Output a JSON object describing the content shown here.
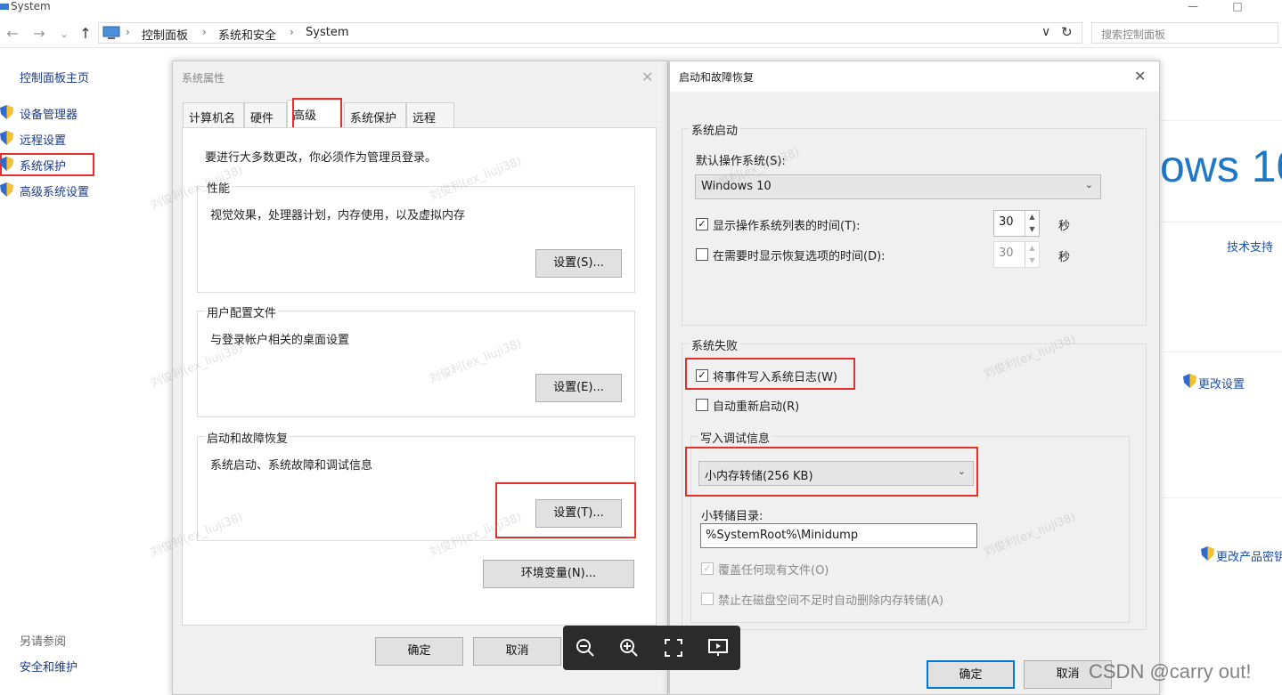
{
  "window": {
    "title": "System",
    "minimize": "—",
    "maximize": "□"
  },
  "nav": {
    "back": "←",
    "forward": "→",
    "history": "⌄",
    "up": "↑",
    "crumbs": [
      "控制面板",
      "系统和安全",
      "System"
    ],
    "dropdown": "∨",
    "refresh": "↻",
    "search_placeholder": "搜索控制面板"
  },
  "sidebar": {
    "home": "控制面板主页",
    "items": [
      "设备管理器",
      "远程设置",
      "系统保护",
      "高级系统设置"
    ],
    "see_also_title": "另请参阅",
    "see_also": [
      "安全和维护"
    ]
  },
  "right_pane": {
    "windows_logo_text": "ows 10",
    "tech_support": "技术支持",
    "change_settings": "更改设置",
    "change_product_key": "更改产品密钥"
  },
  "sys_props": {
    "title": "系统属性",
    "close": "✕",
    "tabs": [
      "计算机名",
      "硬件",
      "高级",
      "系统保护",
      "远程"
    ],
    "admin_note": "要进行大多数更改，你必须作为管理员登录。",
    "performance": {
      "label": "性能",
      "desc": "视觉效果，处理器计划，内存使用，以及虚拟内存",
      "button": "设置(S)..."
    },
    "user_profiles": {
      "label": "用户配置文件",
      "desc": "与登录帐户相关的桌面设置",
      "button": "设置(E)..."
    },
    "startup_recovery": {
      "label": "启动和故障恢复",
      "desc": "系统启动、系统故障和调试信息",
      "button": "设置(T)..."
    },
    "env_button": "环境变量(N)...",
    "ok": "确定",
    "cancel": "取消"
  },
  "startup_dlg": {
    "title": "启动和故障恢复",
    "close": "✕",
    "system_startup": {
      "label": "系统启动",
      "default_os_label": "默认操作系统(S):",
      "default_os_value": "Windows 10",
      "show_os_list_label": "显示操作系统列表的时间(T):",
      "show_os_list_checked": "✓",
      "show_os_list_value": "30",
      "show_recovery_label": "在需要时显示恢复选项的时间(D):",
      "show_recovery_value": "30",
      "seconds": "秒"
    },
    "system_failure": {
      "label": "系统失败",
      "write_event_label": "将事件写入系统日志(W)",
      "write_event_checked": "✓",
      "auto_restart_label": "自动重新启动(R)",
      "debug_info_label": "写入调试信息",
      "dump_type": "小内存转储(256 KB)",
      "dump_dir_label": "小转储目录:",
      "dump_dir_value": "%SystemRoot%\\Minidump",
      "overwrite_label": "覆盖任何现有文件(O)",
      "overwrite_checked": "✓",
      "disable_autodelete_label": "禁止在磁盘空间不足时自动删除内存转储(A)"
    },
    "ok": "确定",
    "cancel": "取消"
  },
  "watermark": "刘俊利(ex_liuji38)",
  "csdn_watermark": "CSDN @carry out!",
  "colors": {
    "accent": "#0078d7",
    "highlight_red": "#e5312e",
    "link": "#1a3a8a"
  }
}
